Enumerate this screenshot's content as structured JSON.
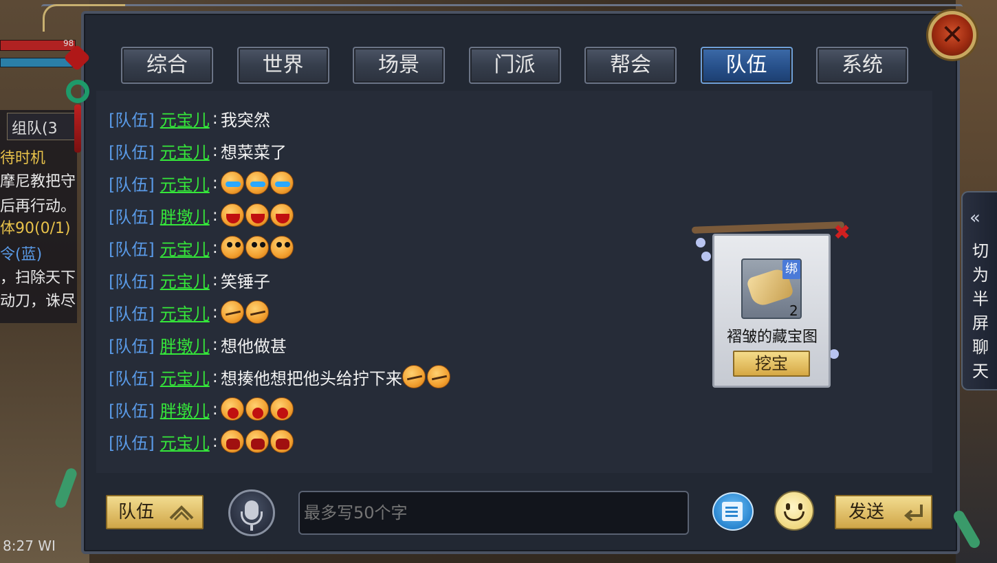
{
  "background": {
    "hp_value": "98",
    "left_tab": "组队(3",
    "left_lines": [
      {
        "text": "待时机",
        "color": "#e8c24a"
      },
      {
        "text": "摩尼教把守",
        "color": "#e8e8e8"
      },
      {
        "text": "后再行动。",
        "color": "#e8e8e8"
      },
      {
        "text": "体90(0/1)",
        "color": "#e8c24a"
      },
      {
        "text": "令(蓝)",
        "color": "#5a9be8"
      },
      {
        "text": "，扫除天下",
        "color": "#e8e8e8"
      },
      {
        "text": "动刀，诛尽",
        "color": "#e8e8e8"
      }
    ],
    "clock": "8:27 WI"
  },
  "tabs": [
    {
      "label": "综合",
      "active": false
    },
    {
      "label": "世界",
      "active": false
    },
    {
      "label": "场景",
      "active": false
    },
    {
      "label": "门派",
      "active": false
    },
    {
      "label": "帮会",
      "active": false
    },
    {
      "label": "队伍",
      "active": true
    },
    {
      "label": "系统",
      "active": false
    }
  ],
  "messages": [
    {
      "channel": "[队伍]",
      "name": "元宝儿",
      "text": "我突然",
      "emojis": []
    },
    {
      "channel": "[队伍]",
      "name": "元宝儿",
      "text": "想菜菜了",
      "emojis": []
    },
    {
      "channel": "[队伍]",
      "name": "元宝儿",
      "text": "",
      "emojis": [
        "cry",
        "cry",
        "cry"
      ]
    },
    {
      "channel": "[队伍]",
      "name": "胖墩儿",
      "text": "",
      "emojis": [
        "angry",
        "angry",
        "angry"
      ]
    },
    {
      "channel": "[队伍]",
      "name": "元宝儿",
      "text": "",
      "emojis": [
        "think",
        "think",
        "think"
      ]
    },
    {
      "channel": "[队伍]",
      "name": "元宝儿",
      "text": "笑锤子",
      "emojis": []
    },
    {
      "channel": "[队伍]",
      "name": "元宝儿",
      "text": "",
      "emojis": [
        "smirk",
        "smirk"
      ]
    },
    {
      "channel": "[队伍]",
      "name": "胖墩儿",
      "text": "想他做甚",
      "emojis": []
    },
    {
      "channel": "[队伍]",
      "name": "元宝儿",
      "text": "想揍他想把他头给拧下来",
      "emojis": [
        "smirk",
        "smirk"
      ]
    },
    {
      "channel": "[队伍]",
      "name": "胖墩儿",
      "text": "",
      "emojis": [
        "shout",
        "shout",
        "shout"
      ]
    },
    {
      "channel": "[队伍]",
      "name": "元宝儿",
      "text": "",
      "emojis": [
        "scream",
        "scream",
        "scream"
      ]
    }
  ],
  "item_popup": {
    "bind_label": "绑",
    "count": "2",
    "item_name": "褶皱的藏宝图",
    "action_label": "挖宝"
  },
  "input_bar": {
    "channel_label": "队伍",
    "placeholder": "最多写50个字",
    "send_label": "发送"
  },
  "side_toggle": {
    "label_chars": [
      "切",
      "为",
      "半",
      "屏",
      "聊",
      "天"
    ]
  },
  "icons": {
    "close": "close-icon",
    "mic": "microphone-icon",
    "quick_phrase": "quick-phrase-icon",
    "emoji": "smiley-icon",
    "enter": "enter-icon",
    "collapse": "double-chevron-left-icon"
  },
  "colors": {
    "channel": "#5a9be8",
    "player_name": "#35e83a",
    "active_tab": "#27508a",
    "gold_button": "#d6a844"
  }
}
